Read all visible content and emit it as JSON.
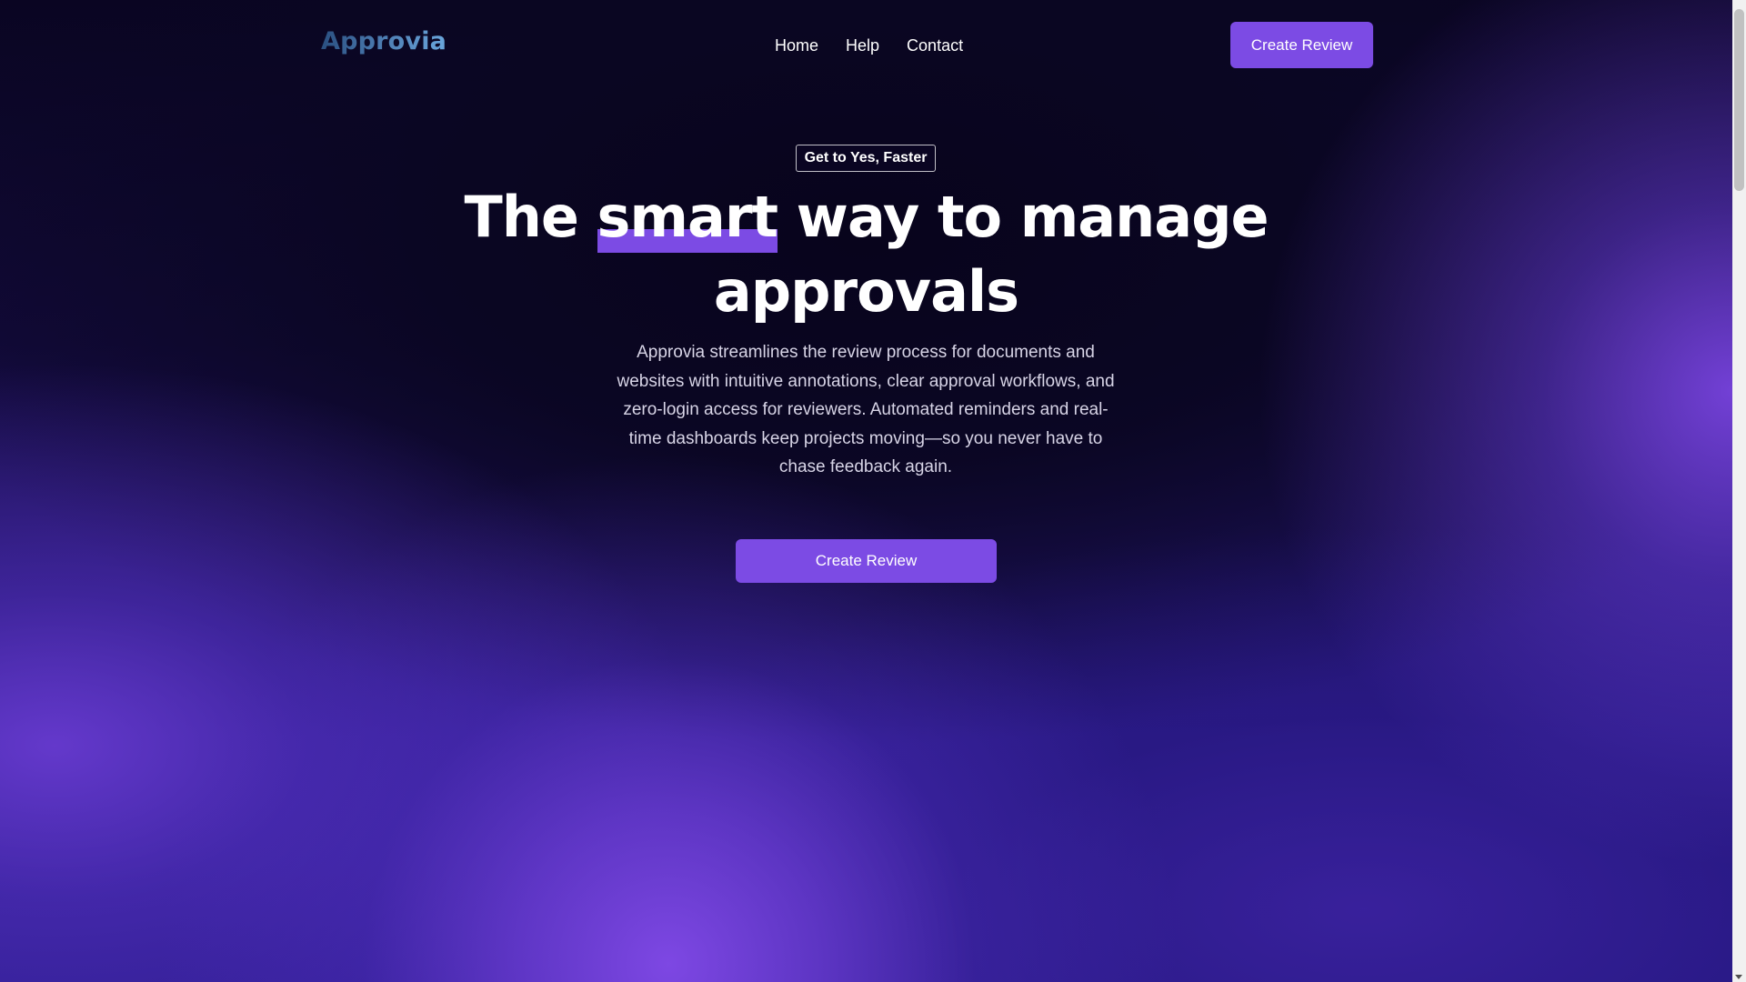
{
  "brand": {
    "logo_text": "Approvia"
  },
  "nav": {
    "links": [
      "Home",
      "Help",
      "Contact"
    ],
    "cta_label": "Create Review"
  },
  "hero": {
    "badge": "Get to Yes, Faster",
    "headline_before": "The ",
    "headline_highlight": "smart",
    "headline_after": " way to manage approvals",
    "description": "Approvia streamlines the review process for documents and websites with intuitive annotations, clear approval workflows, and zero-login access for reviewers. Automated reminders and real-time dashboards keep projects moving—so you never have to chase feedback again.",
    "cta_label": "Create Review"
  },
  "colors": {
    "accent": "#7c4be4",
    "background_dark": "#0a0522",
    "background_purple": "#2b1b8c"
  },
  "icons": {
    "scroll_down": "chevron-down-icon"
  }
}
